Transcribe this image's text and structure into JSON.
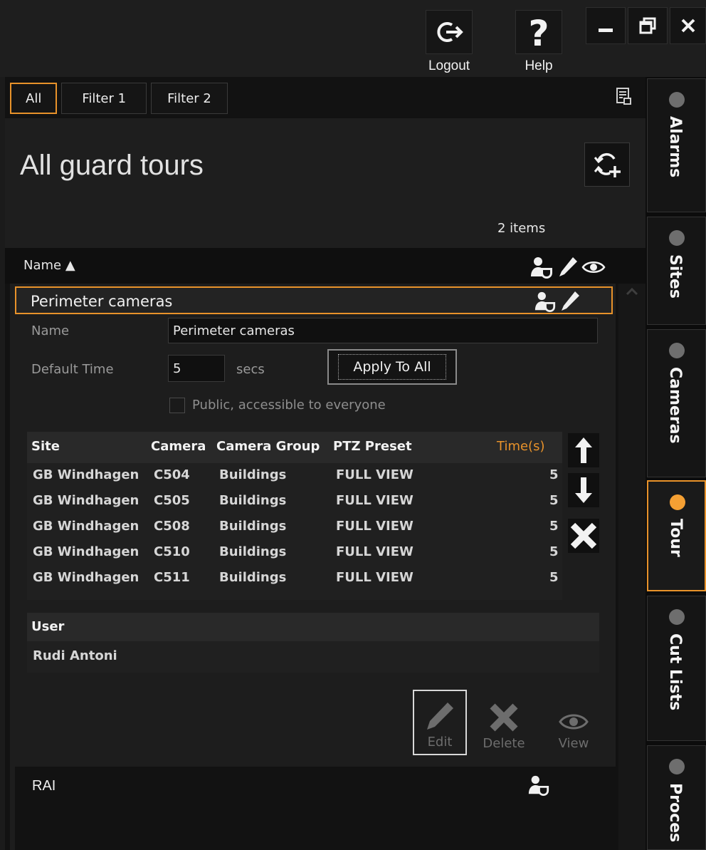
{
  "titlebar": {
    "logout_label": "Logout",
    "help_label": "Help"
  },
  "filters": [
    "All",
    "Filter 1",
    "Filter 2"
  ],
  "page_title": "All guard tours",
  "items_count": "2 items",
  "list_header": {
    "name_col": "Name ▲"
  },
  "tour": {
    "name": "Perimeter cameras",
    "form": {
      "name_label": "Name",
      "name_value": "Perimeter cameras",
      "default_time_label": "Default Time",
      "default_time_value": "5",
      "unit": "secs",
      "apply_all_label": "Apply To All",
      "public_label": "Public, accessible to everyone"
    },
    "camera_table": {
      "headers": [
        "Site",
        "Camera",
        "Camera Group",
        "PTZ Preset",
        "Time(s)"
      ],
      "rows": [
        [
          "GB Windhagen",
          "C504",
          "Buildings",
          "FULL VIEW",
          "5"
        ],
        [
          "GB Windhagen",
          "C505",
          "Buildings",
          "FULL VIEW",
          "5"
        ],
        [
          "GB Windhagen",
          "C508",
          "Buildings",
          "FULL VIEW",
          "5"
        ],
        [
          "GB Windhagen",
          "C510",
          "Buildings",
          "FULL VIEW",
          "5"
        ],
        [
          "GB Windhagen",
          "C511",
          "Buildings",
          "FULL VIEW",
          "5"
        ]
      ]
    },
    "user_table": {
      "header": "User",
      "rows": [
        "Rudi Antoni"
      ]
    },
    "actions": {
      "edit": "Edit",
      "delete": "Delete",
      "view": "View"
    }
  },
  "second_tour": {
    "name": "RAI"
  },
  "side_tabs": [
    "Alarms",
    "Sites",
    "Cameras",
    "Tour",
    "Cut Lists",
    "Proces"
  ],
  "colors": {
    "accent": "#e8922a",
    "active_dot": "#f5a033",
    "inactive_dot": "#6e6e6e"
  }
}
